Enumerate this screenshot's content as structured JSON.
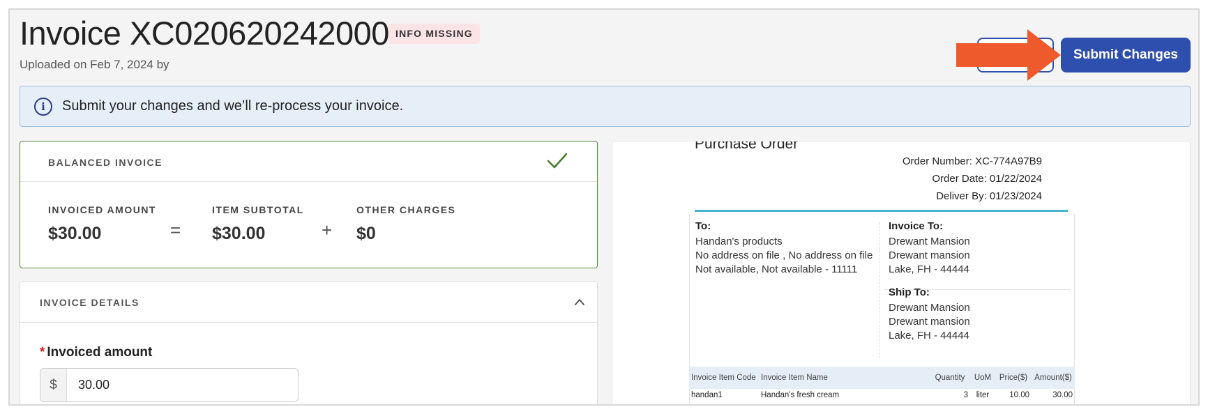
{
  "header": {
    "title": "Invoice XC020620242000",
    "status_badge": "INFO MISSING",
    "subtitle": "Uploaded on Feb 7, 2024 by",
    "submit_label": "Submit Changes"
  },
  "banner": {
    "text": "Submit your changes and we’ll re-process your invoice."
  },
  "balanced_card": {
    "title": "BALANCED INVOICE",
    "invoiced_amount_label": "INVOICED AMOUNT",
    "invoiced_amount_value": "$30.00",
    "equals": "=",
    "item_subtotal_label": "ITEM SUBTOTAL",
    "item_subtotal_value": "$30.00",
    "plus": "+",
    "other_charges_label": "OTHER CHARGES",
    "other_charges_value": "$0"
  },
  "details_card": {
    "title": "INVOICE DETAILS",
    "required_mark": "*",
    "field_label": "Invoiced amount",
    "currency_prefix": "$",
    "field_value": "30.00"
  },
  "document": {
    "title": "Purchase Order",
    "order_number_label": "Order Number:",
    "order_number": "XC-774A97B9",
    "order_date_label": "Order Date:",
    "order_date": "01/22/2024",
    "deliver_by_label": "Deliver By:",
    "deliver_by": "01/23/2024",
    "to": {
      "heading": "To:",
      "lines": [
        "Handan's products",
        "No address on file , No address on file",
        "Not available, Not available - 11111"
      ]
    },
    "invoice_to": {
      "heading": "Invoice To:",
      "lines": [
        "Drewant Mansion",
        "Drewant mansion",
        "Lake, FH - 44444"
      ]
    },
    "ship_to": {
      "heading": "Ship To:",
      "lines": [
        "Drewant Mansion",
        "Drewant mansion",
        "Lake, FH - 44444"
      ]
    },
    "table": {
      "columns": [
        "Invoice Item Code",
        "Invoice Item Name",
        "Quantity",
        "UoM",
        "Price($)",
        "Amount($)"
      ],
      "rows": [
        [
          "handan1",
          "Handan's fresh cream",
          "3",
          "liter",
          "10.00",
          "30.00"
        ]
      ]
    }
  },
  "colors": {
    "primary": "#2f4faf",
    "arrow": "#ee5a2b",
    "success": "#4a8a34",
    "badge_bg": "#fbe3e6",
    "banner_bg": "#e6eff8",
    "rule": "#49b4d0"
  }
}
